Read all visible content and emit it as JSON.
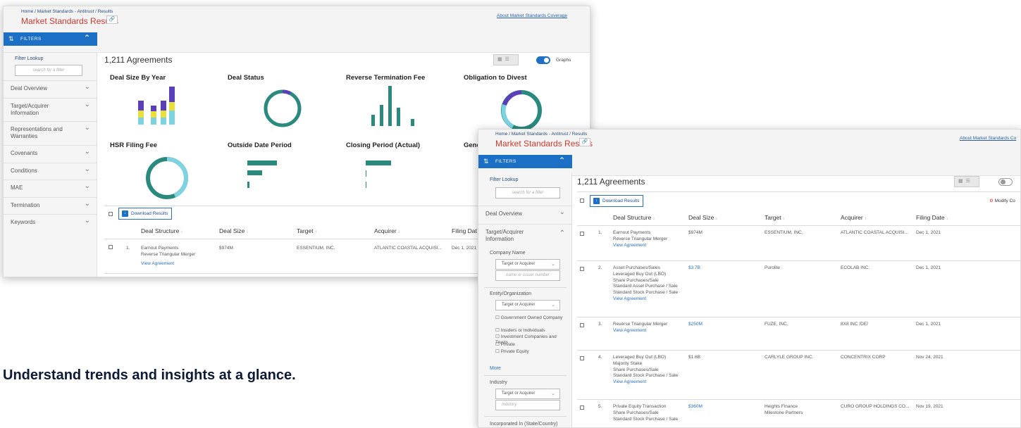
{
  "colors": {
    "brand_blue": "#1b6fc5",
    "title_red": "#d0392f",
    "teal": "#2b8a7e",
    "purple": "#5b3fb8",
    "light_teal": "#7dd3e0",
    "yellow": "#e8df3a"
  },
  "common": {
    "breadcrumb": "Home / Market Standards - Antitrust / Results",
    "page_title": "Market Standards Results",
    "copy_icon": "link-icon",
    "about_link": "About Market Standards Coverage",
    "filters_label": "FILTERS",
    "filter_lookup_label": "Filter Lookup",
    "filter_search_placeholder": "search for a filter",
    "agreements_count": "1,211 Agreements",
    "download_label": "Download Results"
  },
  "s1": {
    "sections": [
      "Deal Overview",
      "Target/Acquirer Information",
      "Representations and Warranties",
      "Covenants",
      "Conditions",
      "MAE",
      "Termination",
      "Keywords"
    ],
    "graphs_label": "Graphs",
    "chart_titles": [
      "Deal Size By Year",
      "Deal Status",
      "Reverse Termination Fee",
      "Obligation to Divest",
      "HSR Filing Fee",
      "Outside Date Period",
      "Closing Period (Actual)",
      "Gene"
    ],
    "columns": [
      "Deal Structure",
      "Deal Size",
      "Target",
      "Acquirer",
      "Filing Dat"
    ],
    "row": {
      "num": "1.",
      "structure": "Earnout Payments\nReverse Triangular Merger",
      "link": "View Agreement",
      "size": "$974M",
      "target": "ESSENTIUM, INC.",
      "acquirer": "ATLANTIC COASTAL ACQUISI...",
      "date": "Dec 1, 2021"
    }
  },
  "s2": {
    "about_link": "About Market Standards Co",
    "modify_label": "Modify Co",
    "sections": {
      "deal_overview": "Deal Overview",
      "target_acquirer": "Target/Acquirer Information"
    },
    "company_name": {
      "label": "Company Name",
      "select": "Target or Acquirer",
      "placeholder": "name or issuer number"
    },
    "entity": {
      "label": "Entity/Organization",
      "select": "Target or Acquirer",
      "options": [
        "Government Owned Company",
        "Insiders or Individuals",
        "Investment Companies and Trusts",
        "Private",
        "Private Equity"
      ],
      "more": "More"
    },
    "industry": {
      "label": "Industry",
      "select": "Target or Acquirer",
      "placeholder": "Industry"
    },
    "incorporated_label": "Incorporated In (State/Country)",
    "columns": [
      "Deal Structure",
      "Deal Size",
      "Target",
      "Acquirer",
      "Filing Date"
    ],
    "rows": [
      {
        "num": "1.",
        "structure": "Earnout Payments\nReverse Triangular Merger",
        "link": "View Agreement",
        "size": "$974M",
        "target": "ESSENTIUM, INC.",
        "acquirer": "ATLANTIC COASTAL ACQUISI...",
        "date": "Dec 1, 2021"
      },
      {
        "num": "2.",
        "structure": "Asset Purchases/Sales\nLeveraged Buy Out (LBO)\nShare Purchases/Sale\nStandard Asset Purchase / Sale\nStandard Stock Purchase / Sale",
        "link": "View Agreement",
        "size": "$3.7B",
        "target": "Purolite",
        "acquirer": "ECOLAB INC.",
        "date": "Dec 1, 2021"
      },
      {
        "num": "3.",
        "structure": "Reverse Triangular Merger",
        "link": "View Agreement",
        "size": "$250M",
        "target": "FUZE, INC.",
        "acquirer": "8X8 INC /DE/",
        "date": "Dec 1, 2021"
      },
      {
        "num": "4.",
        "structure": "Leveraged Buy Out (LBO)\nMajority Stake\nShare Purchases/Sale\nStandard Stock Purchase / Sale",
        "link": "View Agreement",
        "size": "$1.6B",
        "target": "CARLYLE GROUP INC.",
        "acquirer": "CONCENTRIX CORP",
        "date": "Nov 24, 2021"
      },
      {
        "num": "5.",
        "structure": "Private Equity Transaction\nShare Purchases/Sale\nStandard Stock Purchase / Sale",
        "link": "",
        "size": "$360M",
        "target": "Heights Finance\nMilestone Partners",
        "acquirer": "CURO GROUP HOLDINGS CO...",
        "date": "Nov 19, 2021"
      }
    ]
  },
  "tagline": "Understand trends and insights at a glance."
}
